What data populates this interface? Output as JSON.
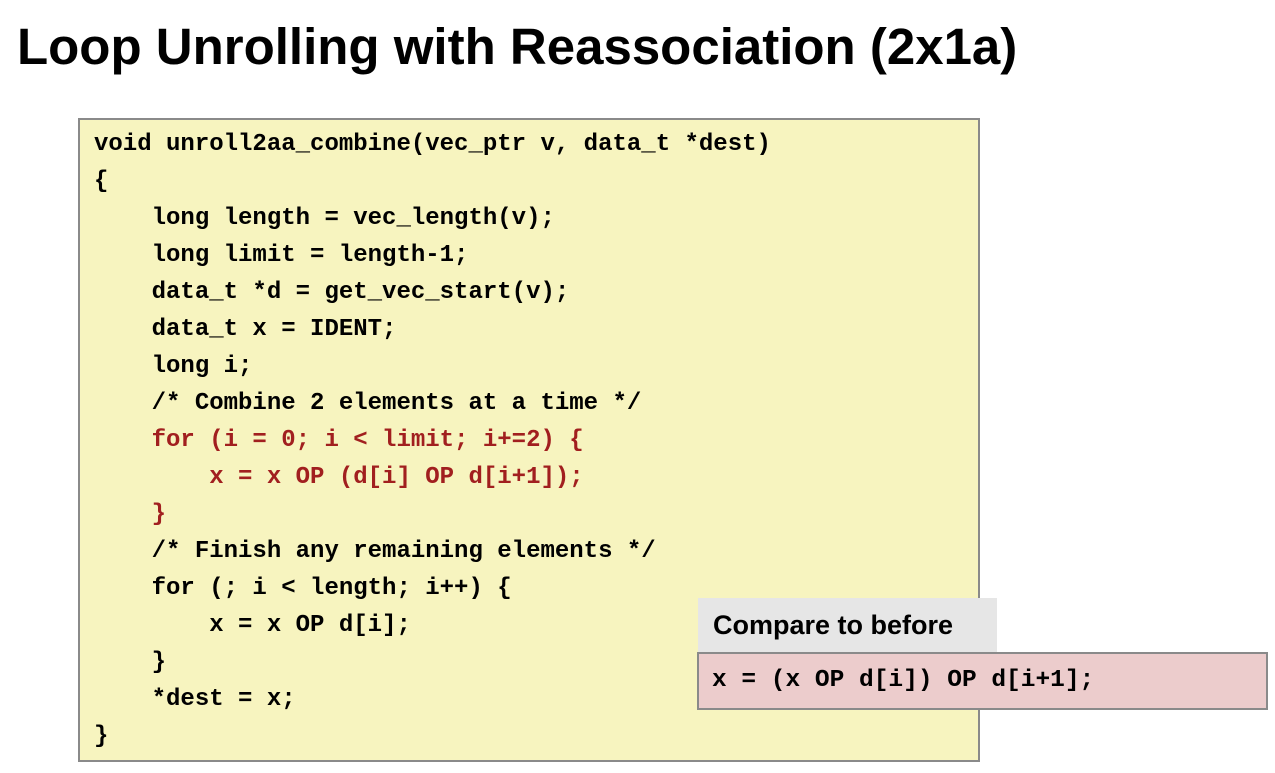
{
  "slide": {
    "title": "Loop Unrolling with Reassociation (2x1a)"
  },
  "code": {
    "lines": [
      {
        "text": "void unroll2aa_combine(vec_ptr v, data_t *dest)",
        "highlight": false
      },
      {
        "text": "{",
        "highlight": false
      },
      {
        "text": "    long length = vec_length(v);",
        "highlight": false
      },
      {
        "text": "    long limit = length-1;",
        "highlight": false
      },
      {
        "text": "    data_t *d = get_vec_start(v);",
        "highlight": false
      },
      {
        "text": "    data_t x = IDENT;",
        "highlight": false
      },
      {
        "text": "    long i;",
        "highlight": false
      },
      {
        "text": "    /* Combine 2 elements at a time */",
        "highlight": false
      },
      {
        "text": "    for (i = 0; i < limit; i+=2) {",
        "highlight": true
      },
      {
        "text": "        x = x OP (d[i] OP d[i+1]);",
        "highlight": true
      },
      {
        "text": "    }",
        "highlight": true
      },
      {
        "text": "    /* Finish any remaining elements */",
        "highlight": false
      },
      {
        "text": "    for (; i < length; i++) {",
        "highlight": false
      },
      {
        "text": "        x = x OP d[i];",
        "highlight": false
      },
      {
        "text": "    }",
        "highlight": false
      },
      {
        "text": "    *dest = x;",
        "highlight": false
      },
      {
        "text": "}",
        "highlight": false
      }
    ]
  },
  "compare": {
    "label": "Compare to before",
    "code": "x = (x OP d[i]) OP d[i+1];"
  },
  "colors": {
    "code_background": "#f7f4bf",
    "highlight_text": "#a11f1f",
    "compare_label_background": "#e6e6e6",
    "compare_code_background": "#eccccc",
    "border": "#8a8a8a"
  }
}
